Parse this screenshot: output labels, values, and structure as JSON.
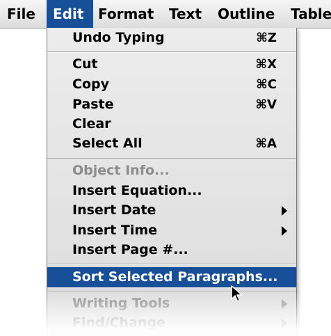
{
  "menubar": {
    "file": "File",
    "edit": "Edit",
    "format": "Format",
    "text": "Text",
    "outline": "Outline",
    "table": "Table"
  },
  "edit_menu": {
    "undo": {
      "label": "Undo Typing",
      "shortcut": "⌘Z"
    },
    "cut": {
      "label": "Cut",
      "shortcut": "⌘X"
    },
    "copy": {
      "label": "Copy",
      "shortcut": "⌘C"
    },
    "paste": {
      "label": "Paste",
      "shortcut": "⌘V"
    },
    "clear": {
      "label": "Clear"
    },
    "select_all": {
      "label": "Select All",
      "shortcut": "⌘A"
    },
    "object_info": {
      "label": "Object Info...",
      "disabled": true
    },
    "insert_equation": {
      "label": "Insert Equation..."
    },
    "insert_date": {
      "label": "Insert Date",
      "submenu": true
    },
    "insert_time": {
      "label": "Insert Time",
      "submenu": true
    },
    "insert_page": {
      "label": "Insert Page #..."
    },
    "sort_paragraphs": {
      "label": "Sort Selected Paragraphs...",
      "highlighted": true
    },
    "writing_tools": {
      "label": "Writing Tools",
      "submenu": true,
      "disabled": true
    },
    "find_change": {
      "label": "Find/Change",
      "submenu": true,
      "disabled": true
    }
  },
  "colors": {
    "highlight": "#174f98",
    "menu_bg": "#e4e4e4",
    "disabled_text": "#8c8c8c"
  },
  "icons": {
    "cursor": "arrow-cursor-icon",
    "submenu": "submenu-arrow-icon"
  }
}
